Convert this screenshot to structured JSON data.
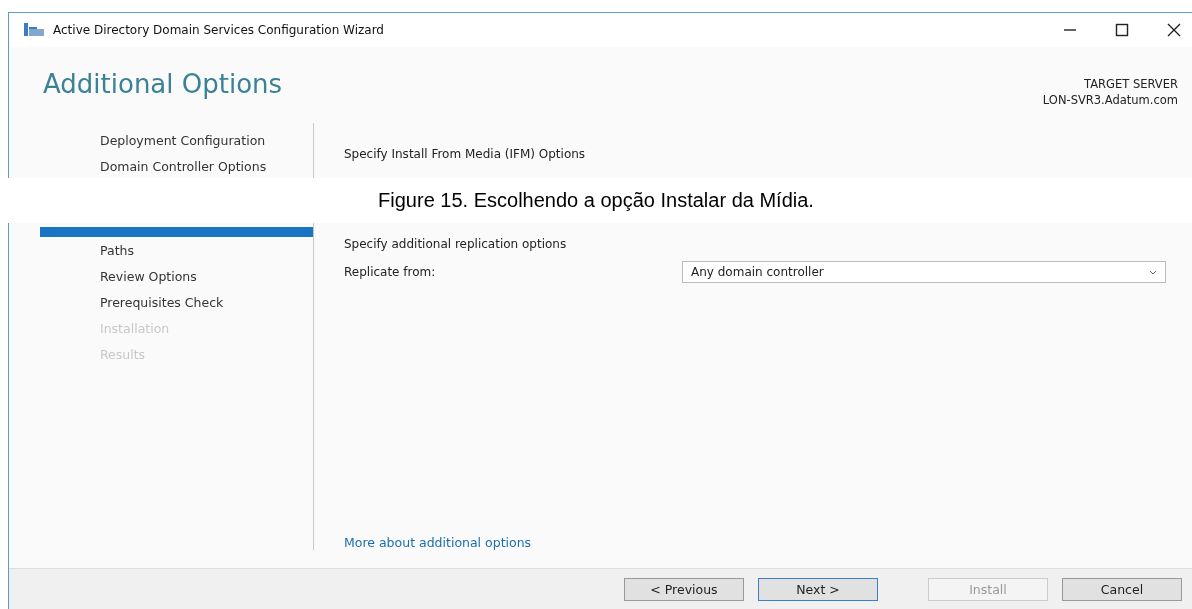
{
  "window": {
    "title": "Active Directory Domain Services Configuration Wizard"
  },
  "heading": "Additional Options",
  "target_server": {
    "label": "TARGET SERVER",
    "name": "LON-SVR3.Adatum.com"
  },
  "sidebar": {
    "items": [
      {
        "label": "Deployment Configuration",
        "selected": false,
        "disabled": false
      },
      {
        "label": "Domain Controller Options",
        "selected": false,
        "disabled": false
      },
      {
        "selected": true
      },
      {
        "label": "Paths",
        "selected": false,
        "disabled": false
      },
      {
        "label": "Review Options",
        "selected": false,
        "disabled": false
      },
      {
        "label": "Prerequisites Check",
        "selected": false,
        "disabled": false
      },
      {
        "label": "Installation",
        "selected": false,
        "disabled": true
      },
      {
        "label": "Results",
        "selected": false,
        "disabled": true
      }
    ]
  },
  "ifm": {
    "heading": "Specify Install From Media (IFM) Options"
  },
  "replication": {
    "heading": "Specify additional replication options",
    "label": "Replicate from:",
    "value": "Any domain controller"
  },
  "link": "More about additional options",
  "buttons": [
    {
      "label": "< Previous",
      "disabled": false,
      "default": false
    },
    {
      "label": "Next >",
      "disabled": false,
      "default": true
    },
    {
      "label": "Install",
      "disabled": true,
      "default": false
    },
    {
      "label": "Cancel",
      "disabled": false,
      "default": false
    }
  ],
  "caption": "Figure 15. Escolhendo a opção Instalar da Mídia."
}
